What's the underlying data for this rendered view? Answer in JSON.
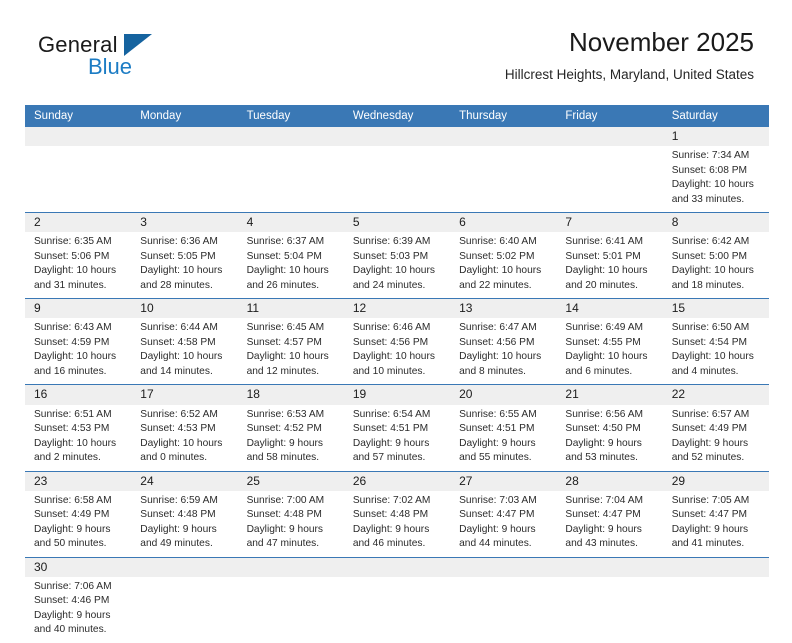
{
  "brand": {
    "word_one": "General",
    "word_two": "Blue",
    "flag_icon": "triangle-flag-icon"
  },
  "header": {
    "title": "November 2025",
    "location": "Hillcrest Heights, Maryland, United States"
  },
  "colors": {
    "header_blue": "#3a78b5",
    "brand_blue": "#1c7cc4",
    "flag_blue": "#15639f",
    "day_band_gray": "#efefef",
    "text": "#222222"
  },
  "calendar": {
    "weekday_headers": [
      "Sunday",
      "Monday",
      "Tuesday",
      "Wednesday",
      "Thursday",
      "Friday",
      "Saturday"
    ],
    "weeks": [
      [
        {
          "day": "",
          "lines": []
        },
        {
          "day": "",
          "lines": []
        },
        {
          "day": "",
          "lines": []
        },
        {
          "day": "",
          "lines": []
        },
        {
          "day": "",
          "lines": []
        },
        {
          "day": "",
          "lines": []
        },
        {
          "day": "1",
          "lines": [
            "Sunrise: 7:34 AM",
            "Sunset: 6:08 PM",
            "Daylight: 10 hours",
            "and 33 minutes."
          ]
        }
      ],
      [
        {
          "day": "2",
          "lines": [
            "Sunrise: 6:35 AM",
            "Sunset: 5:06 PM",
            "Daylight: 10 hours",
            "and 31 minutes."
          ]
        },
        {
          "day": "3",
          "lines": [
            "Sunrise: 6:36 AM",
            "Sunset: 5:05 PM",
            "Daylight: 10 hours",
            "and 28 minutes."
          ]
        },
        {
          "day": "4",
          "lines": [
            "Sunrise: 6:37 AM",
            "Sunset: 5:04 PM",
            "Daylight: 10 hours",
            "and 26 minutes."
          ]
        },
        {
          "day": "5",
          "lines": [
            "Sunrise: 6:39 AM",
            "Sunset: 5:03 PM",
            "Daylight: 10 hours",
            "and 24 minutes."
          ]
        },
        {
          "day": "6",
          "lines": [
            "Sunrise: 6:40 AM",
            "Sunset: 5:02 PM",
            "Daylight: 10 hours",
            "and 22 minutes."
          ]
        },
        {
          "day": "7",
          "lines": [
            "Sunrise: 6:41 AM",
            "Sunset: 5:01 PM",
            "Daylight: 10 hours",
            "and 20 minutes."
          ]
        },
        {
          "day": "8",
          "lines": [
            "Sunrise: 6:42 AM",
            "Sunset: 5:00 PM",
            "Daylight: 10 hours",
            "and 18 minutes."
          ]
        }
      ],
      [
        {
          "day": "9",
          "lines": [
            "Sunrise: 6:43 AM",
            "Sunset: 4:59 PM",
            "Daylight: 10 hours",
            "and 16 minutes."
          ]
        },
        {
          "day": "10",
          "lines": [
            "Sunrise: 6:44 AM",
            "Sunset: 4:58 PM",
            "Daylight: 10 hours",
            "and 14 minutes."
          ]
        },
        {
          "day": "11",
          "lines": [
            "Sunrise: 6:45 AM",
            "Sunset: 4:57 PM",
            "Daylight: 10 hours",
            "and 12 minutes."
          ]
        },
        {
          "day": "12",
          "lines": [
            "Sunrise: 6:46 AM",
            "Sunset: 4:56 PM",
            "Daylight: 10 hours",
            "and 10 minutes."
          ]
        },
        {
          "day": "13",
          "lines": [
            "Sunrise: 6:47 AM",
            "Sunset: 4:56 PM",
            "Daylight: 10 hours",
            "and 8 minutes."
          ]
        },
        {
          "day": "14",
          "lines": [
            "Sunrise: 6:49 AM",
            "Sunset: 4:55 PM",
            "Daylight: 10 hours",
            "and 6 minutes."
          ]
        },
        {
          "day": "15",
          "lines": [
            "Sunrise: 6:50 AM",
            "Sunset: 4:54 PM",
            "Daylight: 10 hours",
            "and 4 minutes."
          ]
        }
      ],
      [
        {
          "day": "16",
          "lines": [
            "Sunrise: 6:51 AM",
            "Sunset: 4:53 PM",
            "Daylight: 10 hours",
            "and 2 minutes."
          ]
        },
        {
          "day": "17",
          "lines": [
            "Sunrise: 6:52 AM",
            "Sunset: 4:53 PM",
            "Daylight: 10 hours",
            "and 0 minutes."
          ]
        },
        {
          "day": "18",
          "lines": [
            "Sunrise: 6:53 AM",
            "Sunset: 4:52 PM",
            "Daylight: 9 hours",
            "and 58 minutes."
          ]
        },
        {
          "day": "19",
          "lines": [
            "Sunrise: 6:54 AM",
            "Sunset: 4:51 PM",
            "Daylight: 9 hours",
            "and 57 minutes."
          ]
        },
        {
          "day": "20",
          "lines": [
            "Sunrise: 6:55 AM",
            "Sunset: 4:51 PM",
            "Daylight: 9 hours",
            "and 55 minutes."
          ]
        },
        {
          "day": "21",
          "lines": [
            "Sunrise: 6:56 AM",
            "Sunset: 4:50 PM",
            "Daylight: 9 hours",
            "and 53 minutes."
          ]
        },
        {
          "day": "22",
          "lines": [
            "Sunrise: 6:57 AM",
            "Sunset: 4:49 PM",
            "Daylight: 9 hours",
            "and 52 minutes."
          ]
        }
      ],
      [
        {
          "day": "23",
          "lines": [
            "Sunrise: 6:58 AM",
            "Sunset: 4:49 PM",
            "Daylight: 9 hours",
            "and 50 minutes."
          ]
        },
        {
          "day": "24",
          "lines": [
            "Sunrise: 6:59 AM",
            "Sunset: 4:48 PM",
            "Daylight: 9 hours",
            "and 49 minutes."
          ]
        },
        {
          "day": "25",
          "lines": [
            "Sunrise: 7:00 AM",
            "Sunset: 4:48 PM",
            "Daylight: 9 hours",
            "and 47 minutes."
          ]
        },
        {
          "day": "26",
          "lines": [
            "Sunrise: 7:02 AM",
            "Sunset: 4:48 PM",
            "Daylight: 9 hours",
            "and 46 minutes."
          ]
        },
        {
          "day": "27",
          "lines": [
            "Sunrise: 7:03 AM",
            "Sunset: 4:47 PM",
            "Daylight: 9 hours",
            "and 44 minutes."
          ]
        },
        {
          "day": "28",
          "lines": [
            "Sunrise: 7:04 AM",
            "Sunset: 4:47 PM",
            "Daylight: 9 hours",
            "and 43 minutes."
          ]
        },
        {
          "day": "29",
          "lines": [
            "Sunrise: 7:05 AM",
            "Sunset: 4:47 PM",
            "Daylight: 9 hours",
            "and 41 minutes."
          ]
        }
      ],
      [
        {
          "day": "30",
          "lines": [
            "Sunrise: 7:06 AM",
            "Sunset: 4:46 PM",
            "Daylight: 9 hours",
            "and 40 minutes."
          ]
        },
        {
          "day": "",
          "lines": []
        },
        {
          "day": "",
          "lines": []
        },
        {
          "day": "",
          "lines": []
        },
        {
          "day": "",
          "lines": []
        },
        {
          "day": "",
          "lines": []
        },
        {
          "day": "",
          "lines": []
        }
      ]
    ]
  }
}
